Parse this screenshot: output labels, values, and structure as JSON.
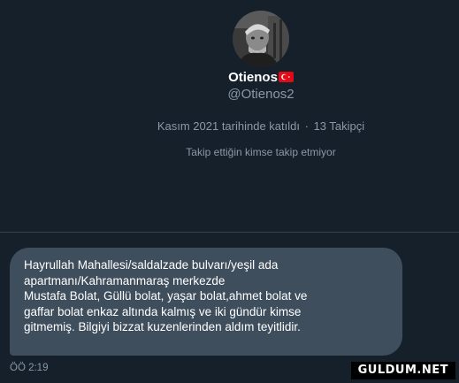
{
  "profile": {
    "display_name": "Otienos",
    "handle": "@Otienos2",
    "joined": "Kasım 2021 tarihinde katıldı",
    "separator": "·",
    "followers": "13 Takipçi",
    "mutual_followers": "Takip ettiğin kimse takip etmiyor",
    "flag_icon": "turkey-flag-icon"
  },
  "message": {
    "lines": [
      "Hayrullah Mahallesi/saldalzade bulvarı/yeşil ada",
      "apartmanı/Kahramanmaraş merkezde",
      "Mustafa Bolat, Güllü bolat, yaşar bolat,ahmet bolat ve",
      "gaffar bolat enkaz altında kalmış ve iki gündür kimse",
      "gitmemiş. Bilgiyi bizzat kuzenlerinden aldım teyitlidir."
    ],
    "timestamp": "ÖÖ 2:19"
  },
  "watermark": "GULDUM.NET",
  "colors": {
    "background": "#15202b",
    "bubble": "#3f4e5c",
    "muted_text": "#8b98a5",
    "divider": "#38444d",
    "flag_red": "#e30a17"
  }
}
